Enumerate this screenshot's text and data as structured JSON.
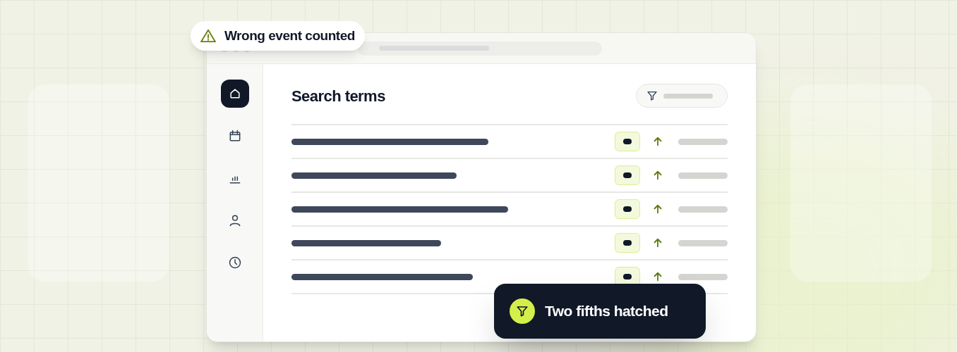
{
  "callout": {
    "text": "Wrong event counted"
  },
  "sidebar": {
    "items": [
      {
        "kind": "home",
        "selected": true
      },
      {
        "kind": "calendar",
        "selected": false
      },
      {
        "kind": "chart",
        "selected": false
      },
      {
        "kind": "user",
        "selected": false
      },
      {
        "kind": "clock",
        "selected": false
      }
    ]
  },
  "panel": {
    "title": "Search terms"
  },
  "rows": [
    {
      "kind": "term"
    },
    {
      "kind": "term"
    },
    {
      "kind": "term"
    },
    {
      "kind": "term"
    },
    {
      "kind": "term"
    }
  ],
  "toast": {
    "text": "Two fifths hatched"
  }
}
